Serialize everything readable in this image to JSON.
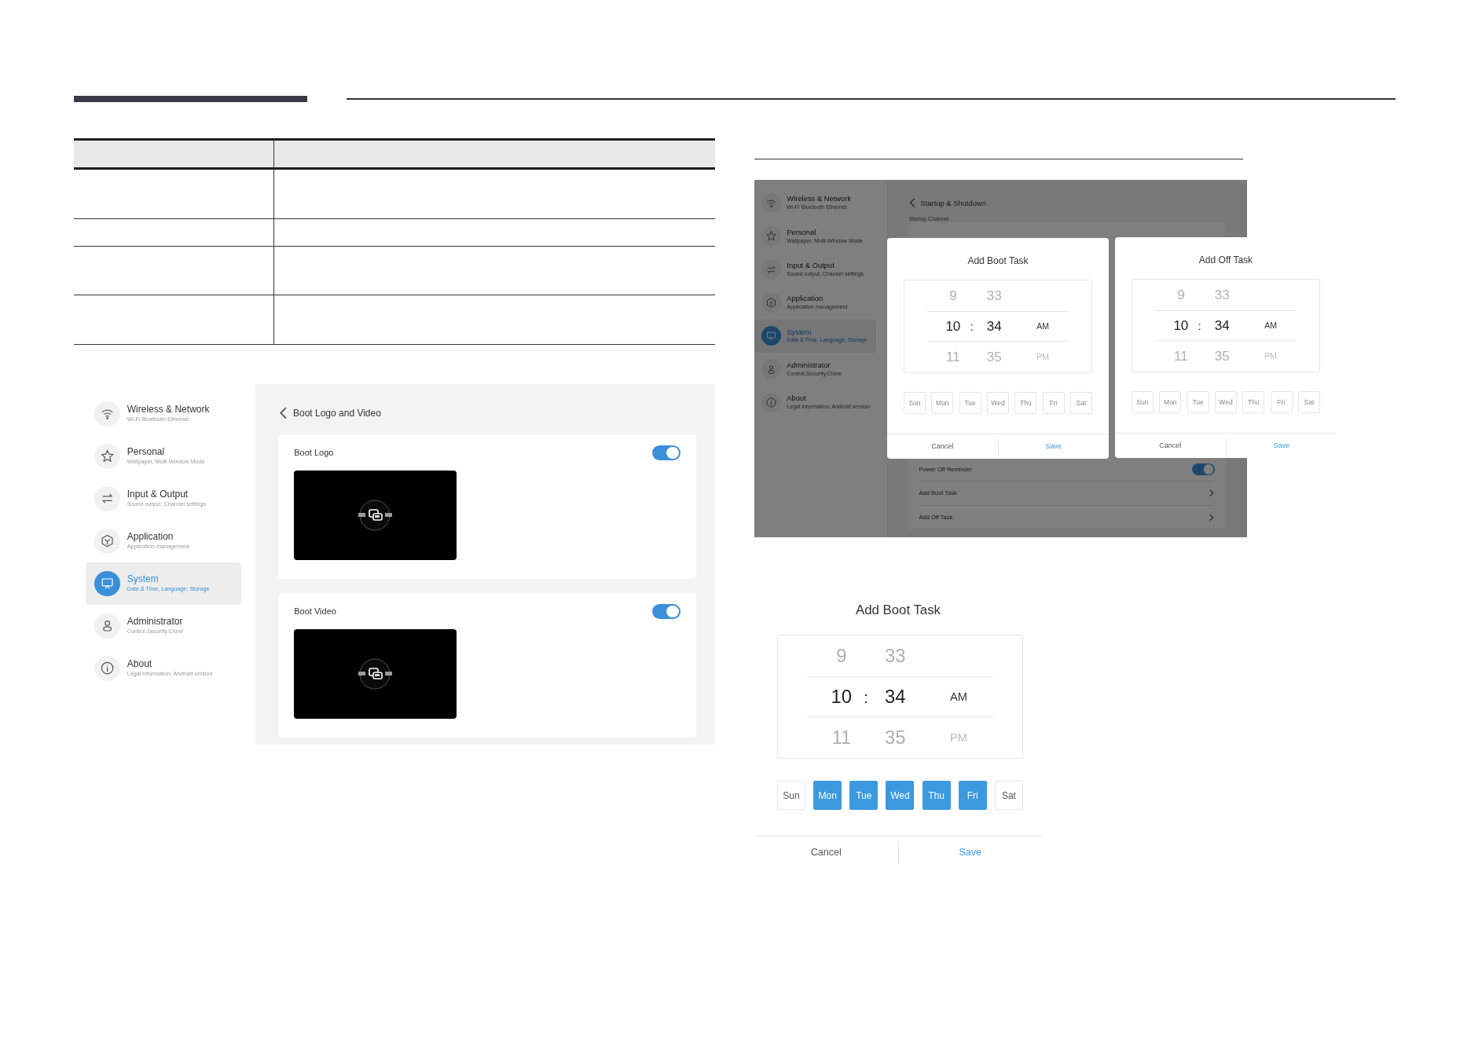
{
  "boot_logo_screen": {
    "sidebar": [
      {
        "title": "Wireless & Network",
        "subtitle": "Wi-Fi Bluetooth Ethernet",
        "selected": false
      },
      {
        "title": "Personal",
        "subtitle": "Wallpaper, Multi-Window Mode",
        "selected": false
      },
      {
        "title": "Input & Output",
        "subtitle": "Sound output, Channel settings",
        "selected": false
      },
      {
        "title": "Application",
        "subtitle": "Application management",
        "selected": false
      },
      {
        "title": "System",
        "subtitle": "Date & Time, Language, Storage",
        "selected": true
      },
      {
        "title": "Administrator",
        "subtitle": "Control,Security,Clone",
        "selected": false
      },
      {
        "title": "About",
        "subtitle": "Legal information, Android version",
        "selected": false
      }
    ],
    "header": {
      "title": "Boot Logo and Video"
    },
    "cards": [
      {
        "title": "Boot Logo",
        "on": true
      },
      {
        "title": "Boot Video",
        "on": true
      }
    ]
  },
  "startup_screen": {
    "sidebar": [
      {
        "title": "Wireless & Network",
        "subtitle": "Wi-Fi Bluetooth Ethernet",
        "selected": false
      },
      {
        "title": "Personal",
        "subtitle": "Wallpaper, Multi-Window Mode",
        "selected": false
      },
      {
        "title": "Input & Output",
        "subtitle": "Sound output, Channel settings",
        "selected": false
      },
      {
        "title": "Application",
        "subtitle": "Application management",
        "selected": false
      },
      {
        "title": "System",
        "subtitle": "Date & Time, Language, Storage",
        "selected": true
      },
      {
        "title": "Administrator",
        "subtitle": "Control,Security,Clone",
        "selected": false
      },
      {
        "title": "About",
        "subtitle": "Legal information, Android version",
        "selected": false
      }
    ],
    "header": {
      "title": "Startup & Shutdown"
    },
    "section_label": "Startup Channel",
    "list": [
      {
        "label": "Power Off Reminder",
        "kind": "toggle",
        "on": true
      },
      {
        "label": "Add Boot Task",
        "kind": "link"
      },
      {
        "label": "Add Off Task",
        "kind": "link"
      }
    ],
    "dialogs": [
      {
        "title": "Add Boot Task",
        "picker": {
          "separator": ":",
          "rows": [
            {
              "hour": "9",
              "minute": "33",
              "selected": false
            },
            {
              "hour": "10",
              "minute": "34",
              "period": "AM",
              "selected": true
            },
            {
              "hour": "11",
              "minute": "35",
              "period": "PM",
              "selected": false
            }
          ]
        },
        "days": [
          {
            "label": "Sun",
            "selected": false
          },
          {
            "label": "Mon",
            "selected": false
          },
          {
            "label": "Tue",
            "selected": false
          },
          {
            "label": "Wed",
            "selected": false
          },
          {
            "label": "Thu",
            "selected": false
          },
          {
            "label": "Fri",
            "selected": false
          },
          {
            "label": "Sat",
            "selected": false
          }
        ],
        "cancel": "Cancel",
        "save": "Save"
      },
      {
        "title": "Add Off Task",
        "picker": {
          "separator": ":",
          "rows": [
            {
              "hour": "9",
              "minute": "33",
              "selected": false
            },
            {
              "hour": "10",
              "minute": "34",
              "period": "AM",
              "selected": true
            },
            {
              "hour": "11",
              "minute": "35",
              "period": "PM",
              "selected": false
            }
          ]
        },
        "days": [
          {
            "label": "Sun",
            "selected": false
          },
          {
            "label": "Mon",
            "selected": false
          },
          {
            "label": "Tue",
            "selected": false
          },
          {
            "label": "Wed",
            "selected": false
          },
          {
            "label": "Thu",
            "selected": false
          },
          {
            "label": "Fri",
            "selected": false
          },
          {
            "label": "Sat",
            "selected": false
          }
        ],
        "cancel": "Cancel",
        "save": "Save"
      }
    ]
  },
  "boot_task_dialog": {
    "title": "Add Boot Task",
    "picker": {
      "separator": ":",
      "rows": [
        {
          "hour": "9",
          "minute": "33",
          "selected": false
        },
        {
          "hour": "10",
          "minute": "34",
          "period": "AM",
          "selected": true
        },
        {
          "hour": "11",
          "minute": "35",
          "period": "PM",
          "selected": false
        }
      ]
    },
    "days": [
      {
        "label": "Sun",
        "selected": false
      },
      {
        "label": "Mon",
        "selected": true
      },
      {
        "label": "Tue",
        "selected": true
      },
      {
        "label": "Wed",
        "selected": true
      },
      {
        "label": "Thu",
        "selected": true
      },
      {
        "label": "Fri",
        "selected": true
      },
      {
        "label": "Sat",
        "selected": false
      }
    ],
    "cancel": "Cancel",
    "save": "Save"
  }
}
